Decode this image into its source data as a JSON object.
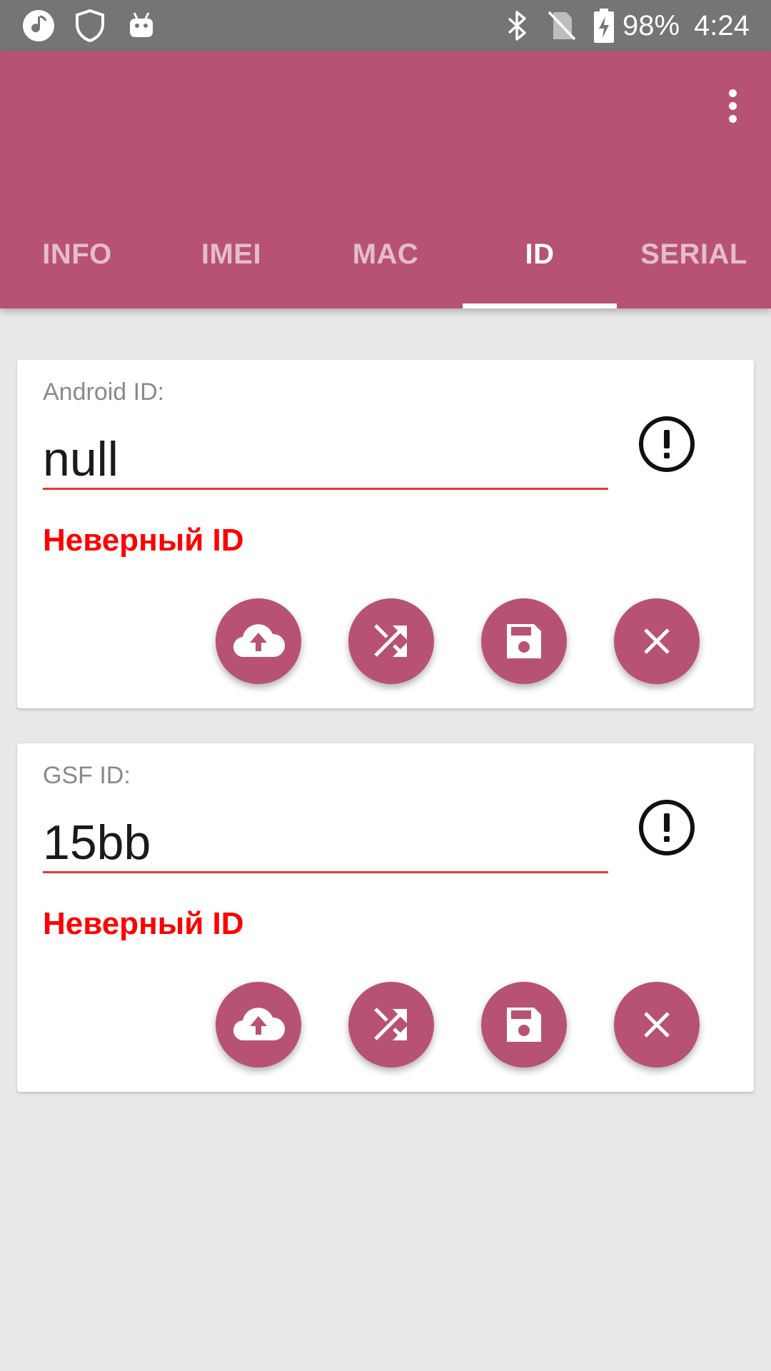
{
  "status_bar": {
    "battery": "98%",
    "time": "4:24",
    "icons": [
      "music-note-icon",
      "shield-icon",
      "android-icon",
      "bluetooth-icon",
      "no-sim-icon",
      "battery-charging-icon"
    ]
  },
  "app_bar": {
    "overflow_icon": "more-vert-icon"
  },
  "tabs": [
    {
      "label": "INFO",
      "active": false
    },
    {
      "label": "IMEI",
      "active": false
    },
    {
      "label": "MAC",
      "active": false
    },
    {
      "label": "ID",
      "active": true
    },
    {
      "label": "SERIAL",
      "active": false
    }
  ],
  "cards": [
    {
      "label": "Android ID:",
      "value": "null",
      "error": "Неверный ID",
      "status_icon": "alert-circle-icon",
      "actions": [
        "cloud-upload-icon",
        "shuffle-icon",
        "save-icon",
        "close-icon"
      ]
    },
    {
      "label": "GSF ID:",
      "value": "15bb",
      "error": "Неверный ID",
      "status_icon": "alert-circle-icon",
      "actions": [
        "cloud-upload-icon",
        "shuffle-icon",
        "save-icon",
        "close-icon"
      ]
    }
  ],
  "colors": {
    "primary": "#b85273",
    "status_bar": "#757575",
    "error": "#ff0000",
    "underline_error": "#e53935",
    "background": "#e8e8e8"
  }
}
